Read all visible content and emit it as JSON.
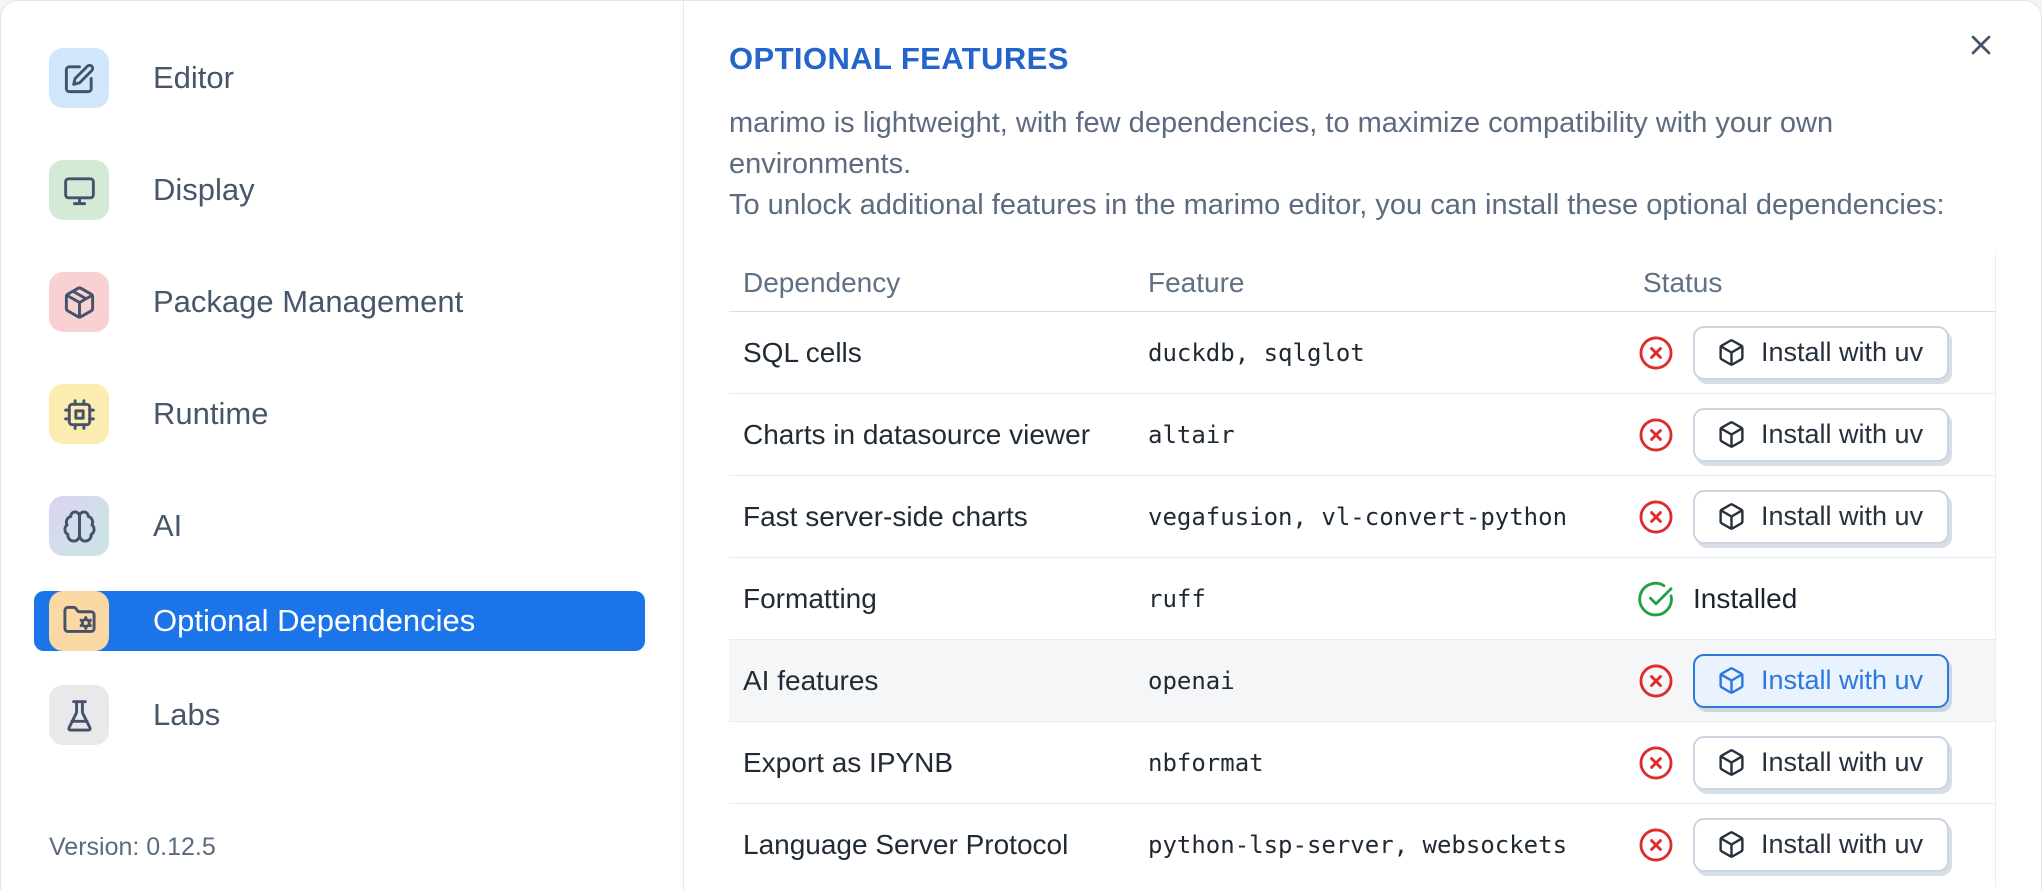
{
  "dialog": {
    "close_icon": "close-x"
  },
  "colors": {
    "selected_item_blue": "#1b75e8",
    "title_blue": "#2565cb",
    "accent_button_blue": "#2b79dd",
    "status_missing_red": "#dc2c2c",
    "status_installed_green": "#22a047"
  },
  "sidebar": {
    "items": [
      {
        "label": "Editor",
        "icon": "edit-pencil-square-icon",
        "selected": false
      },
      {
        "label": "Display",
        "icon": "monitor-icon",
        "selected": false
      },
      {
        "label": "Package Management",
        "icon": "package-box-icon",
        "selected": false
      },
      {
        "label": "Runtime",
        "icon": "cpu-icon",
        "selected": false
      },
      {
        "label": "AI",
        "icon": "brain-icon",
        "selected": false
      },
      {
        "label": "Optional Dependencies",
        "icon": "folder-cog-icon",
        "selected": true
      },
      {
        "label": "Labs",
        "icon": "flask-icon",
        "selected": false
      }
    ],
    "version": "Version: 0.12.5"
  },
  "main": {
    "title": "OPTIONAL FEATURES",
    "description_line1": "marimo is lightweight, with few dependencies, to maximize compatibility with your own environments.",
    "description_line2": "To unlock additional features in the marimo editor, you can install these optional dependencies:",
    "table": {
      "headers": {
        "dependency": "Dependency",
        "feature": "Feature",
        "status": "Status"
      },
      "install_button_label": "Install with uv",
      "rows": [
        {
          "dependency": "SQL cells",
          "feature": "duckdb, sqlglot",
          "status": "missing",
          "action": "Install with uv"
        },
        {
          "dependency": "Charts in datasource viewer",
          "feature": "altair",
          "status": "missing",
          "action": "Install with uv"
        },
        {
          "dependency": "Fast server-side charts",
          "feature": "vegafusion, vl-convert-python",
          "status": "missing",
          "action": "Install with uv"
        },
        {
          "dependency": "Formatting",
          "feature": "ruff",
          "status": "installed",
          "status_label": "Installed"
        },
        {
          "dependency": "AI features",
          "feature": "openai",
          "status": "missing",
          "action": "Install with uv",
          "highlighted": true
        },
        {
          "dependency": "Export as IPYNB",
          "feature": "nbformat",
          "status": "missing",
          "action": "Install with uv"
        },
        {
          "dependency": "Language Server Protocol",
          "feature": "python-lsp-server, websockets",
          "status": "missing",
          "action": "Install with uv"
        }
      ]
    }
  }
}
